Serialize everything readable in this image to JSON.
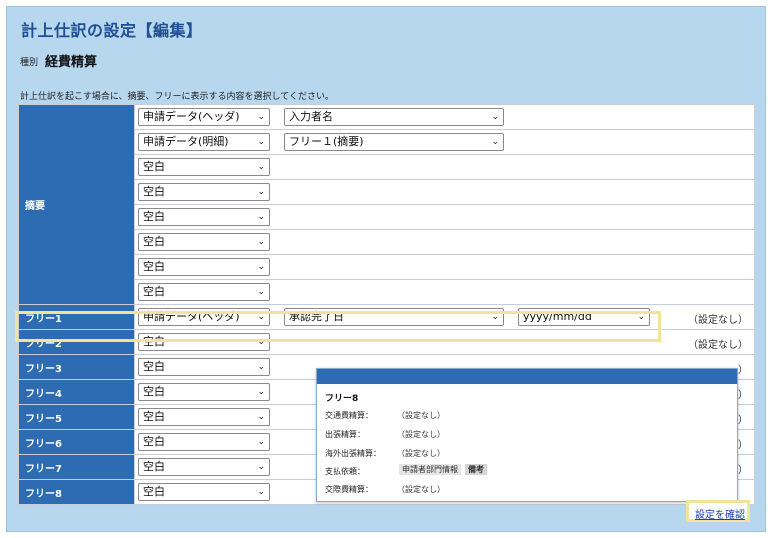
{
  "title": "計上仕訳の設定【編集】",
  "category": {
    "label": "種別",
    "value": "経費精算"
  },
  "description": "計上仕訳を起こす場合に、摘要、フリーに表示する内容を選択してください。",
  "chevron": "❯",
  "summary": {
    "label": "摘要",
    "rows": [
      {
        "sel1": "申請データ(ヘッダ)",
        "sel2": "入力者名"
      },
      {
        "sel1": "申請データ(明細)",
        "sel2": "フリー１(摘要)"
      },
      {
        "sel1": "空白"
      },
      {
        "sel1": "空白"
      },
      {
        "sel1": "空白"
      },
      {
        "sel1": "空白"
      },
      {
        "sel1": "空白"
      },
      {
        "sel1": "空白"
      }
    ]
  },
  "free_rows": [
    {
      "label": "フリー1",
      "sel1": "申請データ(ヘッダ)",
      "sel2": "承認完了日",
      "sel3": "yyyy/mm/dd",
      "status": "（設定なし）"
    },
    {
      "label": "フリー2",
      "sel1": "空白",
      "status": "（設定なし）"
    },
    {
      "label": "フリー3",
      "sel1": "空白",
      "status": "）"
    },
    {
      "label": "フリー4",
      "sel1": "空白",
      "status": "）"
    },
    {
      "label": "フリー5",
      "sel1": "空白",
      "status": "）"
    },
    {
      "label": "フリー6",
      "sel1": "空白",
      "status": "）"
    },
    {
      "label": "フリー7",
      "sel1": "空白",
      "status": "）"
    },
    {
      "label": "フリー8",
      "sel1": "空白"
    }
  ],
  "confirm_link": "設定を確認",
  "popup": {
    "title": "フリー8",
    "rows": [
      {
        "label": "交通費精算：",
        "value": "（設定なし）"
      },
      {
        "label": "出張精算：",
        "value": "（設定なし）"
      },
      {
        "label": "海外出張精算：",
        "value": "（設定なし）"
      },
      {
        "label": "支払依頼：",
        "value": "申請者部門情報",
        "extra": "備考"
      },
      {
        "label": "交際費精算：",
        "value": "（設定なし）"
      }
    ]
  },
  "colors": {
    "background": "#b7d7ef",
    "header_cell": "#2d6cb3",
    "title": "#1f4f94",
    "highlight": "#f3e39a",
    "link": "#1a3fb0"
  }
}
